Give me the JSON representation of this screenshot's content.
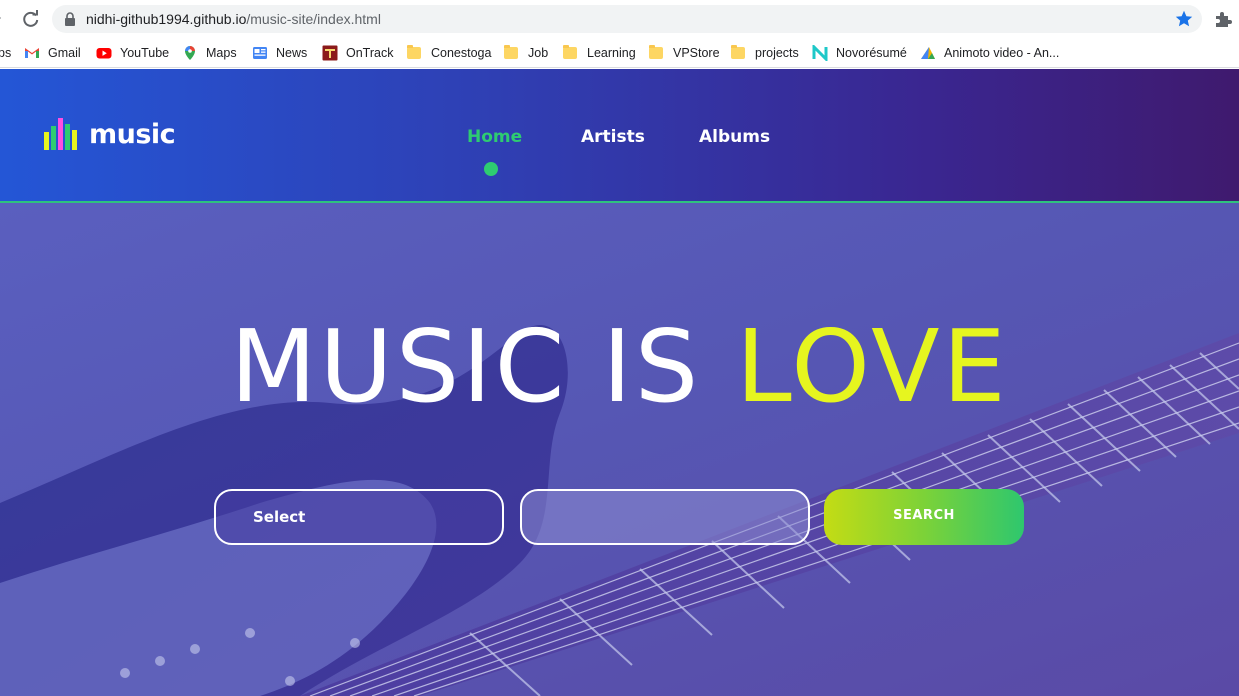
{
  "browser": {
    "url_host": "nidhi-github1994.github.io",
    "url_path": "/music-site/index.html",
    "bookmarks": [
      {
        "label": "Gmail",
        "icon": "gmail-icon"
      },
      {
        "label": "YouTube",
        "icon": "youtube-icon"
      },
      {
        "label": "Maps",
        "icon": "maps-icon"
      },
      {
        "label": "News",
        "icon": "news-icon"
      },
      {
        "label": "OnTrack",
        "icon": "ontrack-icon"
      },
      {
        "label": "Conestoga",
        "icon": "folder-icon"
      },
      {
        "label": "Job",
        "icon": "folder-icon"
      },
      {
        "label": "Learning",
        "icon": "folder-icon"
      },
      {
        "label": "VPStore",
        "icon": "folder-icon"
      },
      {
        "label": "projects",
        "icon": "folder-icon"
      },
      {
        "label": "Novorésumé",
        "icon": "novoresume-icon"
      },
      {
        "label": "Animoto video - An...",
        "icon": "animoto-icon"
      }
    ],
    "apps_partial": "ps"
  },
  "site": {
    "logo_text": "music",
    "nav": [
      {
        "label": "Home",
        "active": true
      },
      {
        "label": "Artists",
        "active": false
      },
      {
        "label": "Albums",
        "active": false
      }
    ],
    "hero": {
      "headline_main": "MUSIC IS ",
      "headline_accent": "LOVE",
      "select_label": "Select",
      "search_value": "",
      "search_button": "SEARCH"
    },
    "colors": {
      "accent_green": "#2ecc71",
      "accent_yellow": "#e6f51f",
      "header_start": "#2456d6",
      "header_end": "#3f1a6e"
    }
  }
}
